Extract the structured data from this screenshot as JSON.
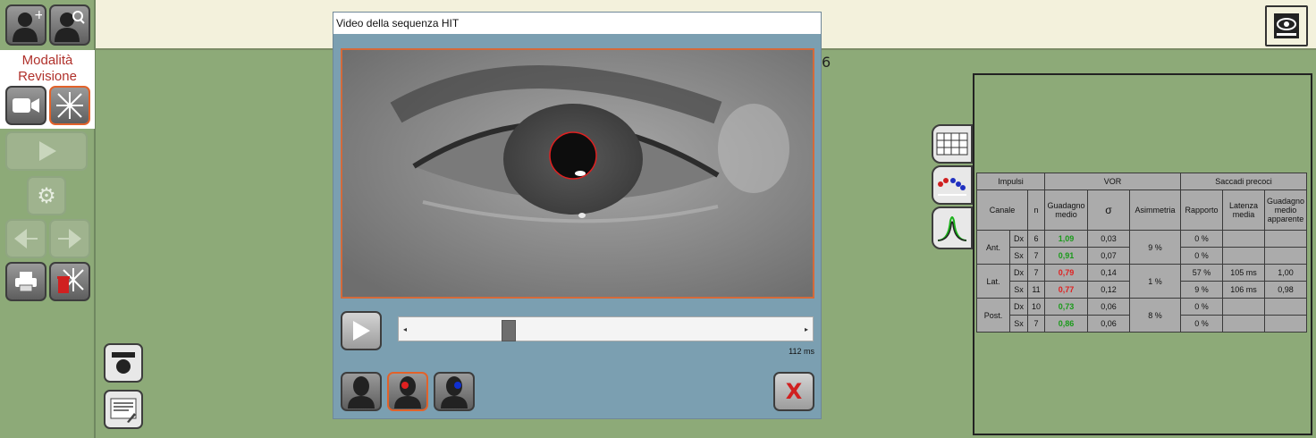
{
  "mode": {
    "line1": "Modalità",
    "line2": "Revisione"
  },
  "dialog": {
    "title": "Video della sequenza HIT",
    "time": "112 ms",
    "close_symbol": "X",
    "scroll_position": 0.24
  },
  "background_digit": "6",
  "table": {
    "headers": {
      "impulsi": "Impulsi",
      "vor": "VOR",
      "saccadi": "Saccadi precoci",
      "canale": "Canale",
      "n": "n",
      "guadagno": "Guadagno medio",
      "sigma": "σ",
      "asimmetria": "Asimmetria",
      "rapporto": "Rapporto",
      "latenza": "Latenza media",
      "guadagno_app": "Guadagno medio apparente"
    },
    "groups": [
      {
        "label": "Ant.",
        "asym": "9 %",
        "rows": [
          {
            "side": "Dx",
            "n": "6",
            "gain": "1,09",
            "color": "g",
            "sigma": "0,03",
            "ratio": "0 %",
            "lat": "",
            "gapp": ""
          },
          {
            "side": "Sx",
            "n": "7",
            "gain": "0,91",
            "color": "g",
            "sigma": "0,07",
            "ratio": "0 %",
            "lat": "",
            "gapp": ""
          }
        ]
      },
      {
        "label": "Lat.",
        "asym": "1 %",
        "rows": [
          {
            "side": "Dx",
            "n": "7",
            "gain": "0,79",
            "color": "r",
            "sigma": "0,14",
            "ratio": "57 %",
            "lat": "105 ms",
            "gapp": "1,00"
          },
          {
            "side": "Sx",
            "n": "11",
            "gain": "0,77",
            "color": "r",
            "sigma": "0,12",
            "ratio": "9 %",
            "lat": "106 ms",
            "gapp": "0,98"
          }
        ]
      },
      {
        "label": "Post.",
        "asym": "8 %",
        "rows": [
          {
            "side": "Dx",
            "n": "10",
            "gain": "0,73",
            "color": "g",
            "sigma": "0,06",
            "ratio": "0 %",
            "lat": "",
            "gapp": ""
          },
          {
            "side": "Sx",
            "n": "7",
            "gain": "0,86",
            "color": "g",
            "sigma": "0,06",
            "ratio": "0 %",
            "lat": "",
            "gapp": ""
          }
        ]
      }
    ]
  },
  "colors": {
    "accent": "#e2622a",
    "panel_green": "#8daa78",
    "gain_ok": "#1a9a1a",
    "gain_low": "#e02020"
  }
}
